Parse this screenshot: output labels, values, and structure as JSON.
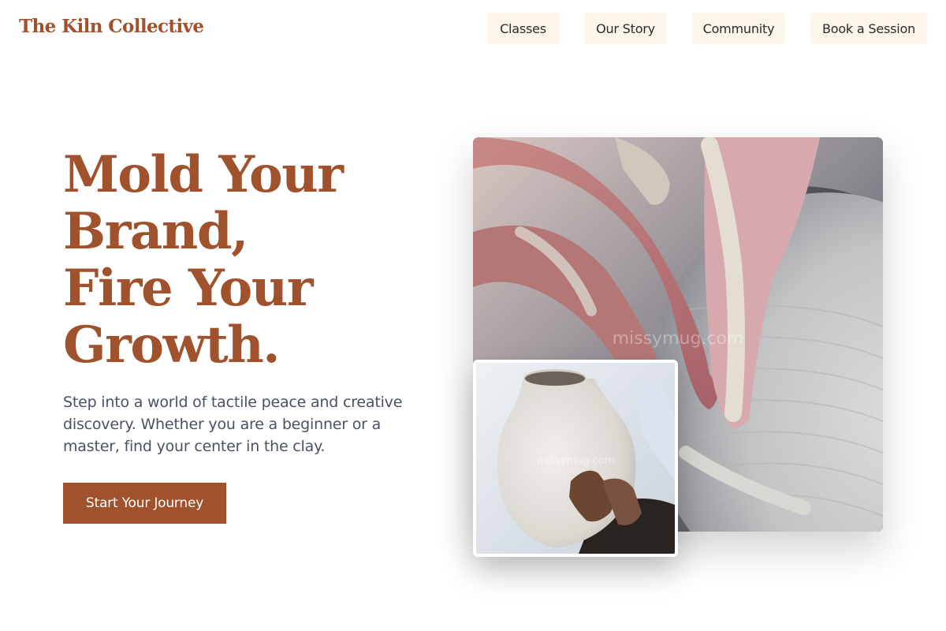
{
  "header": {
    "logo": "The Kiln Collective",
    "nav": [
      {
        "label": "Classes"
      },
      {
        "label": "Our Story"
      },
      {
        "label": "Community"
      },
      {
        "label": "Book a Session"
      }
    ]
  },
  "hero": {
    "title_lines": [
      "Mold Your",
      "Brand,",
      "Fire Your",
      "Growth."
    ],
    "subtitle": "Step into a world of tactile peace and creative discovery. Whether you are a beginner or a master, find your center in the clay.",
    "cta_label": "Start Your Journey"
  },
  "images": {
    "main_watermark": "missymug.com",
    "inset_watermark": "missymug.com"
  },
  "colors": {
    "accent": "#a0522d",
    "nav_bg": "#fcf6ea",
    "text_muted": "#4a5161"
  }
}
